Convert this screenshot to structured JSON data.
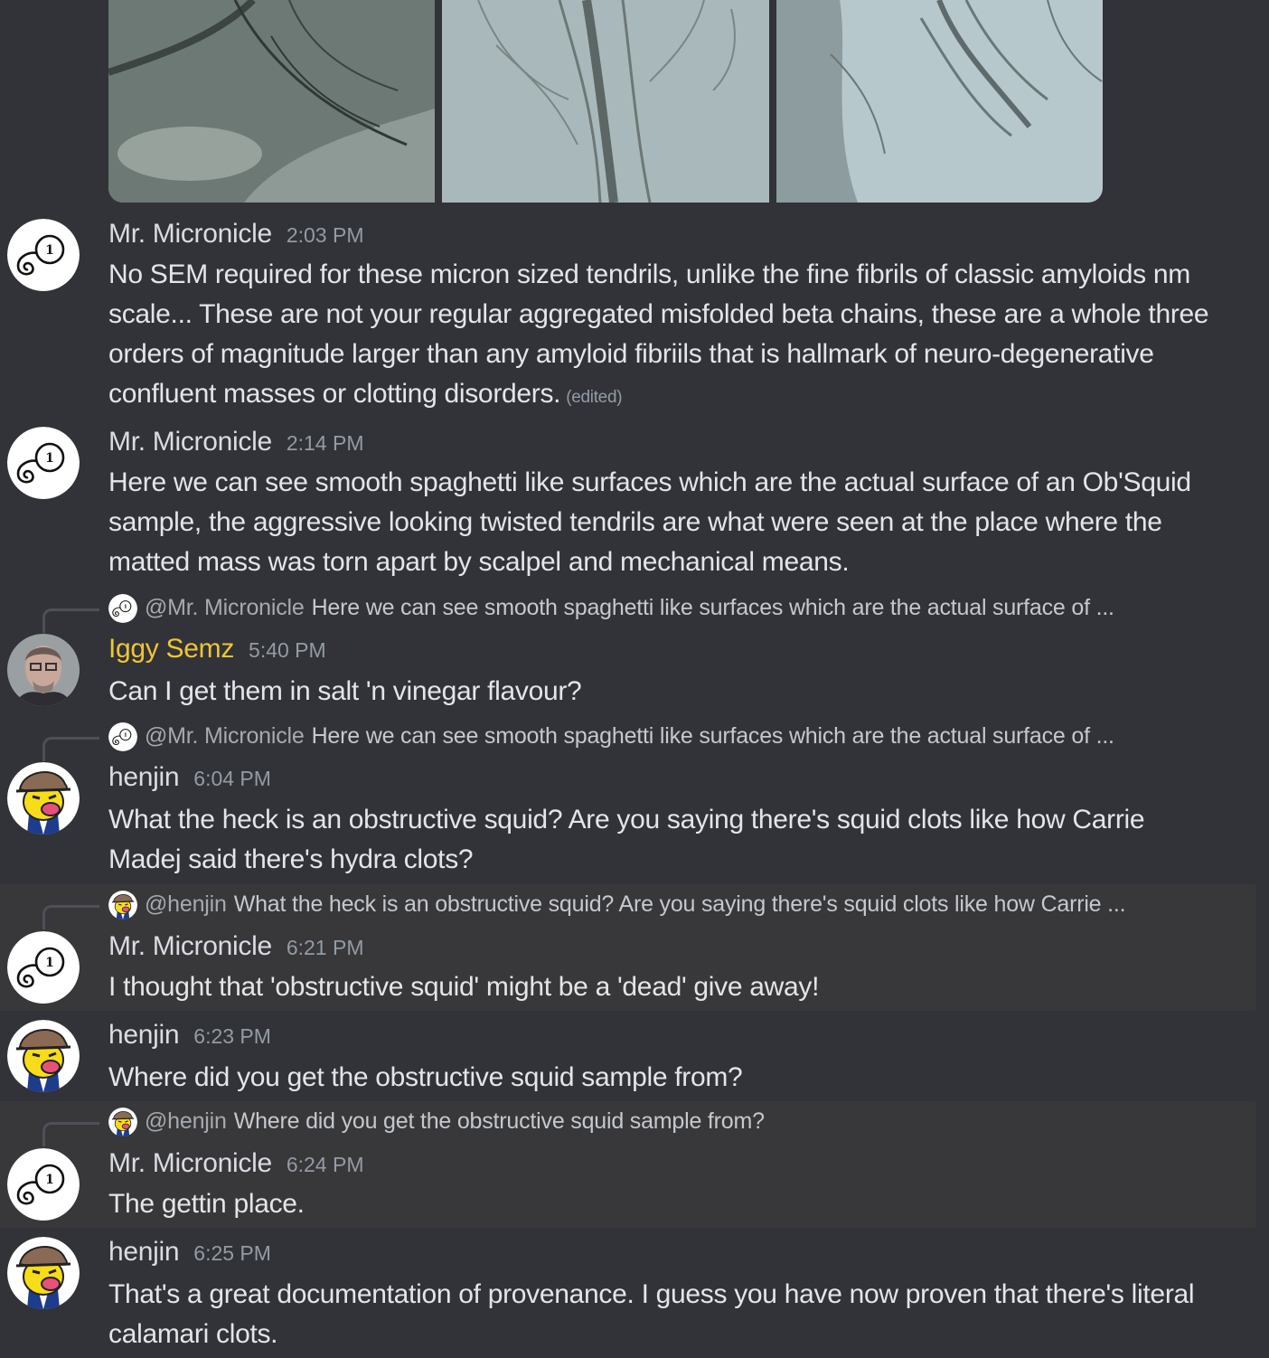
{
  "messages": [
    {
      "author": "Mr. Micronicle",
      "time": "2:03 PM",
      "text": "No SEM required for these micron sized tendrils, unlike the fine fibrils of classic amyloids nm scale... These are not your regular aggregated misfolded beta chains, these are a whole three orders of magnitude larger than any amyloid fibriils that is hallmark of neuro-degenerative confluent masses or clotting disorders.",
      "edited": "(edited)"
    },
    {
      "author": "Mr. Micronicle",
      "time": "2:14 PM",
      "text": "Here we can see smooth spaghetti like surfaces which are the actual surface of an Ob'Squid sample, the aggressive looking twisted tendrils are what were seen at the place where the matted mass was torn apart by scalpel and mechanical means."
    },
    {
      "reply": {
        "name": "@Mr. Micronicle",
        "text": "Here we can see smooth spaghetti like surfaces which are the actual surface of ..."
      },
      "author": "Iggy Semz",
      "time": "5:40 PM",
      "text": "Can I get them in salt 'n vinegar flavour?"
    },
    {
      "reply": {
        "name": "@Mr. Micronicle",
        "text": "Here we can see smooth spaghetti like surfaces which are the actual surface of ..."
      },
      "author": "henjin",
      "time": "6:04 PM",
      "text": "What the heck is an obstructive squid? Are you saying there's squid clots like how Carrie Madej said there's hydra clots?"
    },
    {
      "reply": {
        "name": "@henjin",
        "text": "What the heck is an obstructive squid? Are you saying there's squid clots like how Carrie ..."
      },
      "author": "Mr. Micronicle",
      "time": "6:21 PM",
      "text": "I thought that 'obstructive squid' might be a 'dead' give away!"
    },
    {
      "author": "henjin",
      "time": "6:23 PM",
      "text": "Where did you get the obstructive squid sample from?"
    },
    {
      "reply": {
        "name": "@henjin",
        "text": "Where did you get the obstructive squid sample from?"
      },
      "author": "Mr. Micronicle",
      "time": "6:24 PM",
      "text": "The gettin place."
    },
    {
      "author": "henjin",
      "time": "6:25 PM",
      "text": "That's a great documentation of provenance. I guess you have now proven that there's literal calamari clots."
    }
  ]
}
